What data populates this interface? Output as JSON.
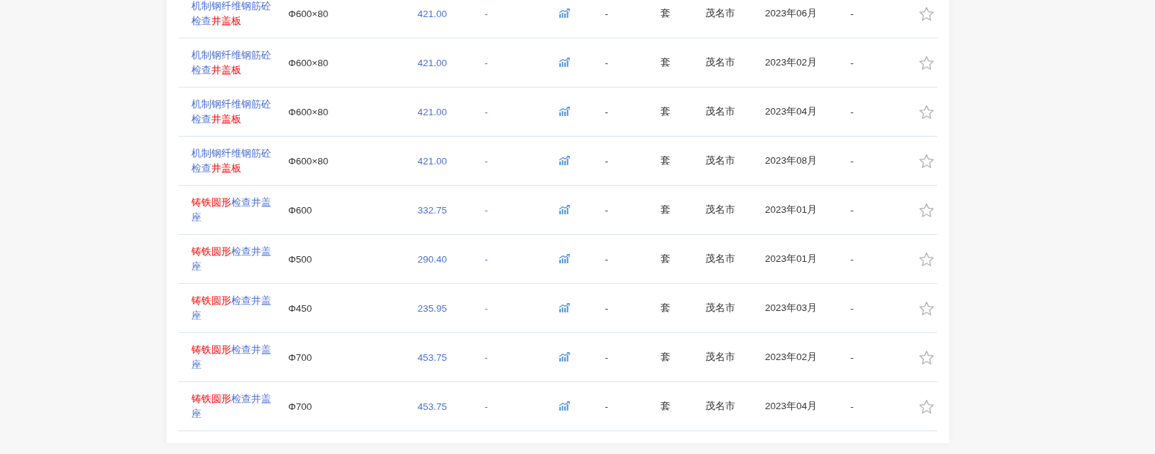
{
  "rows": [
    {
      "name": [
        {
          "text": "机制钢纤维钢筋砼检查",
          "highlight": false
        },
        {
          "text": "井盖板",
          "highlight": true
        }
      ],
      "spec": "Φ600×80",
      "price": "421.00",
      "column_4": "-",
      "column_6": "-",
      "unit": "套",
      "city": "茂名市",
      "date": "2023年06月",
      "column_10": "-"
    },
    {
      "name": [
        {
          "text": "机制钢纤维钢筋砼检查",
          "highlight": false
        },
        {
          "text": "井盖板",
          "highlight": true
        }
      ],
      "spec": "Φ600×80",
      "price": "421.00",
      "column_4": "-",
      "column_6": "-",
      "unit": "套",
      "city": "茂名市",
      "date": "2023年02月",
      "column_10": "-"
    },
    {
      "name": [
        {
          "text": "机制钢纤维钢筋砼检查",
          "highlight": false
        },
        {
          "text": "井盖板",
          "highlight": true
        }
      ],
      "spec": "Φ600×80",
      "price": "421.00",
      "column_4": "-",
      "column_6": "-",
      "unit": "套",
      "city": "茂名市",
      "date": "2023年04月",
      "column_10": "-"
    },
    {
      "name": [
        {
          "text": "机制钢纤维钢筋砼检查",
          "highlight": false
        },
        {
          "text": "井盖板",
          "highlight": true
        }
      ],
      "spec": "Φ600×80",
      "price": "421.00",
      "column_4": "-",
      "column_6": "-",
      "unit": "套",
      "city": "茂名市",
      "date": "2023年08月",
      "column_10": "-"
    },
    {
      "name": [
        {
          "text": "铸铁圆形",
          "highlight": true
        },
        {
          "text": "检查井盖座",
          "highlight": false
        }
      ],
      "spec": "Φ600",
      "price": "332.75",
      "column_4": "-",
      "column_6": "-",
      "unit": "套",
      "city": "茂名市",
      "date": "2023年01月",
      "column_10": "-"
    },
    {
      "name": [
        {
          "text": "铸铁圆形",
          "highlight": true
        },
        {
          "text": "检查井盖座",
          "highlight": false
        }
      ],
      "spec": "Φ500",
      "price": "290.40",
      "column_4": "-",
      "column_6": "-",
      "unit": "套",
      "city": "茂名市",
      "date": "2023年01月",
      "column_10": "-"
    },
    {
      "name": [
        {
          "text": "铸铁圆形",
          "highlight": true
        },
        {
          "text": "检查井盖座",
          "highlight": false
        }
      ],
      "spec": "Φ450",
      "price": "235.95",
      "column_4": "-",
      "column_6": "-",
      "unit": "套",
      "city": "茂名市",
      "date": "2023年03月",
      "column_10": "-"
    },
    {
      "name": [
        {
          "text": "铸铁圆形",
          "highlight": true
        },
        {
          "text": "检查井盖座",
          "highlight": false
        }
      ],
      "spec": "Φ700",
      "price": "453.75",
      "column_4": "-",
      "column_6": "-",
      "unit": "套",
      "city": "茂名市",
      "date": "2023年02月",
      "column_10": "-"
    },
    {
      "name": [
        {
          "text": "铸铁圆形",
          "highlight": true
        },
        {
          "text": "检查井盖座",
          "highlight": false
        }
      ],
      "spec": "Φ700",
      "price": "453.75",
      "column_4": "-",
      "column_6": "-",
      "unit": "套",
      "city": "茂名市",
      "date": "2023年04月",
      "column_10": "-"
    }
  ]
}
